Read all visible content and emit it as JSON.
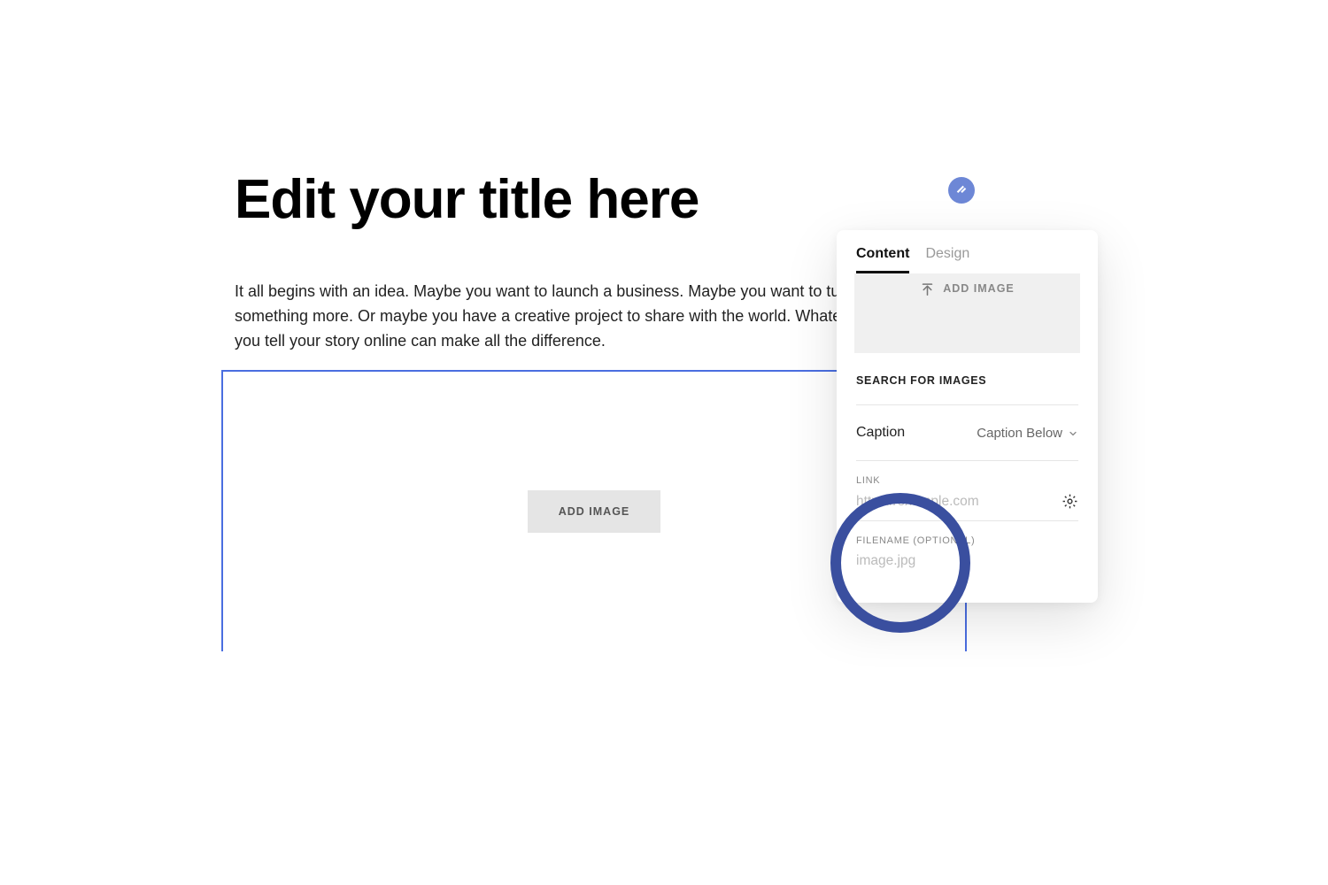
{
  "page": {
    "title": "Edit your title here",
    "body": "It all begins with an idea. Maybe you want to launch a business. Maybe you want to turn a hobby into something more. Or maybe you have a creative project to share with the world. Whatever it is, the way you tell your story online can make all the difference."
  },
  "image_block": {
    "button_label": "ADD IMAGE"
  },
  "panel": {
    "tabs": {
      "content": "Content",
      "design": "Design"
    },
    "add_image_label": "ADD IMAGE",
    "search_images_label": "SEARCH FOR IMAGES",
    "caption": {
      "label": "Caption",
      "value": "Caption Below"
    },
    "link": {
      "label": "LINK",
      "placeholder": "https://example.com"
    },
    "filename": {
      "label": "FILENAME (OPTIONAL)",
      "placeholder": "image.jpg"
    }
  }
}
